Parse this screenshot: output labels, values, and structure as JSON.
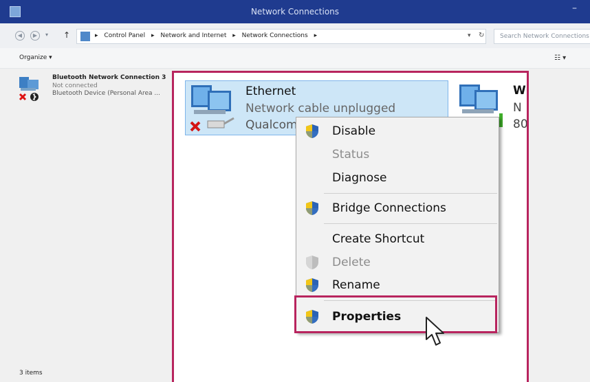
{
  "window": {
    "title": "Network Connections"
  },
  "address": {
    "breadcrumbs": [
      "Control Panel",
      "Network and Internet",
      "Network Connections"
    ],
    "search_placeholder": "Search Network Connections"
  },
  "command_bar": {
    "organize_label": "Organize ▾"
  },
  "connections": [
    {
      "name": "Bluetooth Network Connection 3",
      "status": "Not connected",
      "device": "Bluetooth Device (Personal Area ..."
    }
  ],
  "status_bar": {
    "item_count": "3 items"
  },
  "zoom": {
    "ethernet": {
      "name": "Ethernet",
      "status": "Network cable unplugged",
      "device": "Qualcom"
    },
    "wifi": {
      "name": "W",
      "status": "N",
      "device": "80"
    }
  },
  "context_menu": {
    "items": [
      {
        "label": "Disable",
        "icon": "uac-shield-icon",
        "enabled": true
      },
      {
        "label": "Status",
        "icon": null,
        "enabled": false
      },
      {
        "label": "Diagnose",
        "icon": null,
        "enabled": true
      },
      {
        "label": "Bridge Connections",
        "icon": "uac-shield-icon",
        "enabled": true
      },
      {
        "label": "Create Shortcut",
        "icon": null,
        "enabled": true
      },
      {
        "label": "Delete",
        "icon": "uac-shield-icon",
        "enabled": false
      },
      {
        "label": "Rename",
        "icon": "uac-shield-icon",
        "enabled": true
      },
      {
        "label": "Properties",
        "icon": "uac-shield-icon",
        "enabled": true,
        "default": true
      }
    ]
  },
  "colors": {
    "titlebar": "#1f3b8f",
    "highlight_border": "#b8245e",
    "selection_fill": "#cde6f7",
    "selection_border": "#7eb4ea"
  }
}
